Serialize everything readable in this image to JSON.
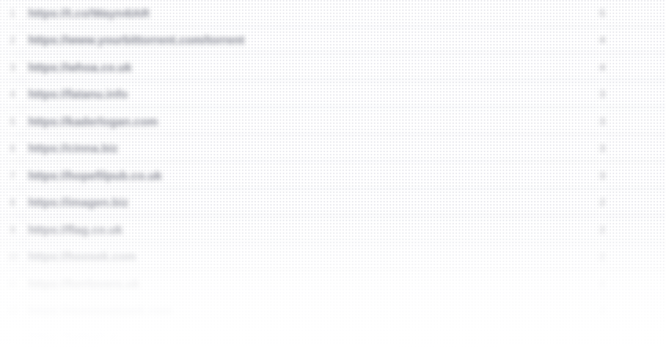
{
  "rows": [
    {
      "index": "1",
      "url": "https://t.co/Wayn4IAR",
      "count": "5"
    },
    {
      "index": "2",
      "url": "https://www.yourbittorrent.com/torrent",
      "count": "4"
    },
    {
      "index": "3",
      "url": "https://whoa.co.uk",
      "count": "4"
    },
    {
      "index": "4",
      "url": "https://fatanu.info",
      "count": "3"
    },
    {
      "index": "5",
      "url": "https://kaderlogan.com",
      "count": "3"
    },
    {
      "index": "6",
      "url": "https://cinna.biz",
      "count": "3"
    },
    {
      "index": "7",
      "url": "https://hopefilpub.co.uk",
      "count": "3"
    },
    {
      "index": "8",
      "url": "https://imagen.biz",
      "count": "2"
    },
    {
      "index": "9",
      "url": "https://flag.co.uk",
      "count": "2"
    },
    {
      "index": "10",
      "url": "https://hoosek.com",
      "count": "2"
    },
    {
      "index": "11",
      "url": "https://forrlovers.uk",
      "count": "2"
    },
    {
      "index": "12",
      "url": "https://nuevonetuark.com",
      "count": "2"
    },
    {
      "index": "13",
      "url": "https://kalinot.gr",
      "count": "1"
    }
  ]
}
